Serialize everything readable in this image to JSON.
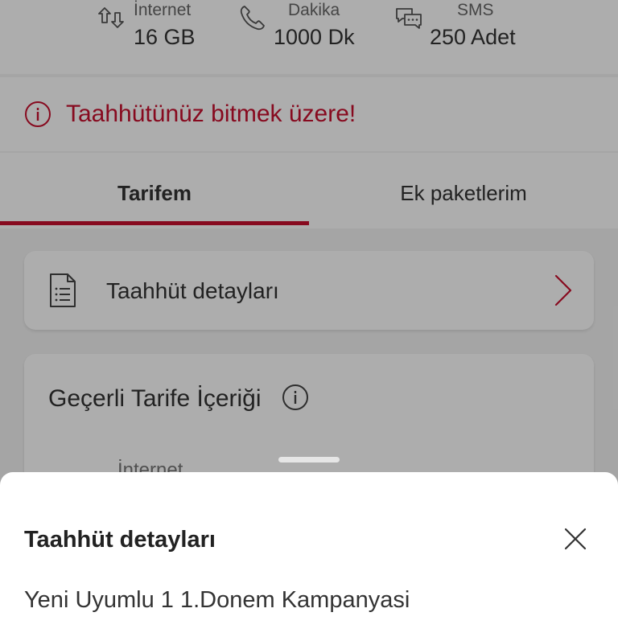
{
  "usage": {
    "items": [
      {
        "icon": "data-transfer-icon",
        "label": "İnternet",
        "value": "16 GB"
      },
      {
        "icon": "phone-icon",
        "label": "Dakika",
        "value": "1000 Dk"
      },
      {
        "icon": "chat-icon",
        "label": "SMS",
        "value": "250 Adet"
      }
    ]
  },
  "warning": {
    "text": "Taahhütünüz bitmek üzere!",
    "icon": "info-icon"
  },
  "tabs": [
    {
      "label": "Tarifem",
      "active": true
    },
    {
      "label": "Ek paketlerim",
      "active": false
    }
  ],
  "commitment_card": {
    "label": "Taahhüt detayları",
    "icon": "document-icon"
  },
  "tariff_card": {
    "title": "Geçerli Tarife İçeriği",
    "partial_item": "İnternet"
  },
  "sheet": {
    "title": "Taahhüt detayları",
    "body": "Yeni Uyumlu 1 1.Donem Kampanyasi"
  },
  "colors": {
    "accent": "#c8102e",
    "text": "#333333",
    "muted": "#666666"
  }
}
